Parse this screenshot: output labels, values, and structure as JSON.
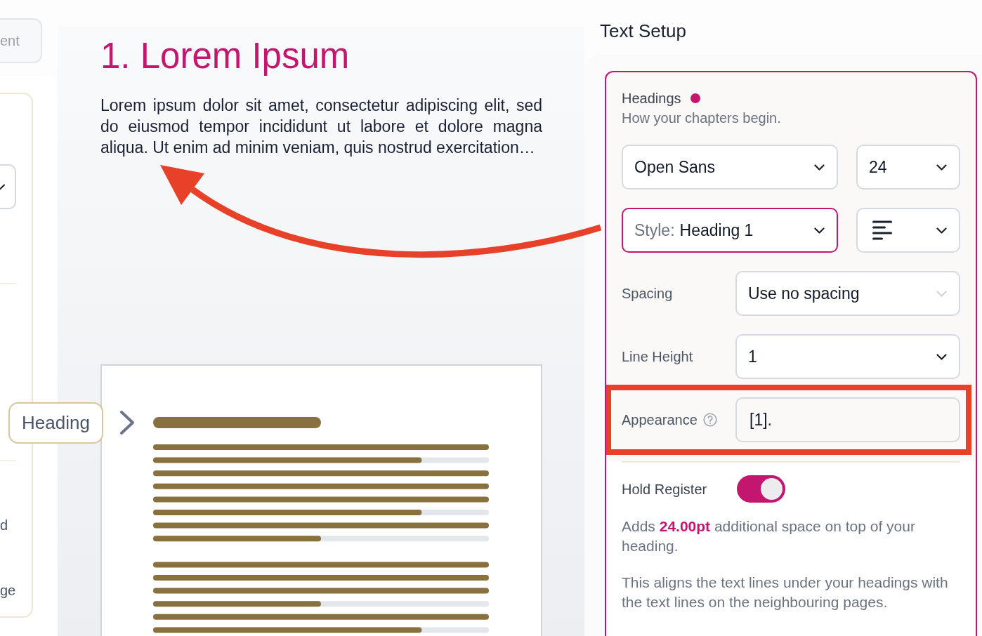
{
  "sidebar": {
    "button_label": "ent",
    "fragments": [
      "d",
      "ge"
    ]
  },
  "preview": {
    "heading": "1. Lorem Ipsum",
    "paragraph": "Lorem ipsum dolor sit amet, consectetur adipiscing elit, sed do eiusmod tempor incididunt ut labore et dolore magna aliqua. Ut enim ad minim veniam, quis nostrud exercitation…",
    "callout": "Heading"
  },
  "text_setup": {
    "title": "Text Setup",
    "section": {
      "title": "Headings",
      "modified": true,
      "subtitle": "How your chapters begin.",
      "selects": [
        {
          "kind": "text",
          "value": "Open Sans",
          "focused": false
        },
        {
          "kind": "text",
          "value": "24",
          "focused": false
        },
        {
          "kind": "text",
          "prefix": "Style:",
          "value": "Heading 1",
          "focused": true
        },
        {
          "kind": "alignment",
          "focused": false
        }
      ],
      "rows": [
        {
          "kind": "select",
          "label": "Spacing",
          "value": "Use no spacing",
          "help": false,
          "disabled": true,
          "highlighted": false
        },
        {
          "kind": "select",
          "label": "Line Height",
          "value": "1",
          "help": false,
          "disabled": false,
          "highlighted": false
        },
        {
          "kind": "input",
          "label": "Appearance",
          "value": "[1].",
          "help": true,
          "disabled": false,
          "highlighted": true
        }
      ],
      "hold_register": {
        "label": "Hold Register",
        "on": true
      },
      "notes": [
        "Adds **24.00pt** additional space on top of your heading.",
        "This aligns the text lines under your headings with the text lines on the neighbouring pages."
      ]
    }
  }
}
